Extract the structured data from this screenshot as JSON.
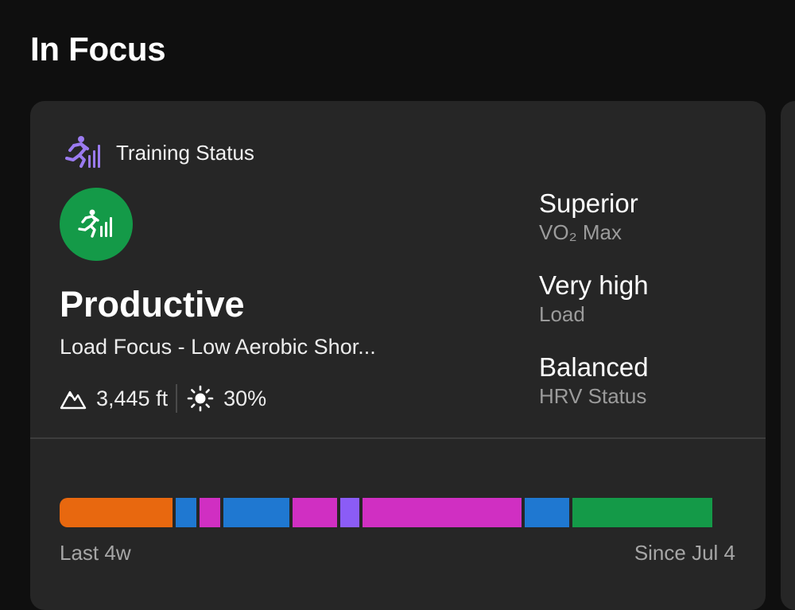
{
  "section": {
    "title": "In Focus"
  },
  "card": {
    "header_title": "Training Status",
    "header_icon": "training-status-icon",
    "status": {
      "label": "Productive",
      "icon": "runner-bars-icon",
      "color": "#149a48"
    },
    "focus_text": "Load Focus - Low Aerobic Shor...",
    "conditions": {
      "altitude_icon": "mountain-icon",
      "altitude": "3,445 ft",
      "heat_icon": "sun-icon",
      "heat": "30%"
    },
    "metrics": [
      {
        "value": "Superior",
        "label": "VO₂ Max"
      },
      {
        "value": "Very high",
        "label": "Load"
      },
      {
        "value": "Balanced",
        "label": "HRV Status"
      }
    ],
    "history": {
      "start_label": "Last 4w",
      "end_label": "Since Jul 4",
      "segments": [
        {
          "color": "#e8680f",
          "share": 0.174
        },
        {
          "color": "#1f78d1",
          "share": 0.031
        },
        {
          "color": "#d02fc2",
          "share": 0.032
        },
        {
          "color": "#1f78d1",
          "share": 0.102
        },
        {
          "color": "#d02fc2",
          "share": 0.068
        },
        {
          "color": "#8b5cf6",
          "share": 0.03
        },
        {
          "color": "#d02fc2",
          "share": 0.244
        },
        {
          "color": "#1f78d1",
          "share": 0.068
        },
        {
          "color": "#149a48",
          "share": 0.215
        }
      ]
    }
  }
}
